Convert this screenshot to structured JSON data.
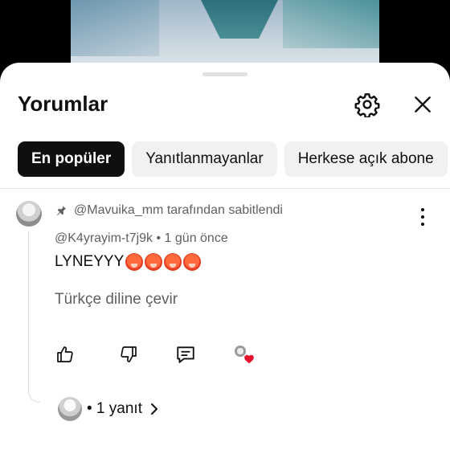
{
  "sheet": {
    "title": "Yorumlar"
  },
  "filters": [
    {
      "label": "En popüler",
      "active": true
    },
    {
      "label": "Yanıtlanmayanlar",
      "active": false
    },
    {
      "label": "Herkese açık abone",
      "active": false
    }
  ],
  "comment": {
    "pinned_text": "@Mavuika_mm tarafından sabitlendi",
    "author": "@K4yrayim-t7j9k",
    "time": "• 1 gün önce",
    "text": "LYNEYYY",
    "emoji_names": [
      "hot-face-emoji",
      "hot-face-emoji",
      "hot-face-emoji",
      "hot-face-emoji"
    ],
    "translate_label": "Türkçe diline çevir",
    "replies_label": "• 1 yanıt"
  },
  "colors": {
    "accent_active_chip": "#0f0f0f",
    "secondary_text": "#606060",
    "heart": "#e5112d"
  }
}
